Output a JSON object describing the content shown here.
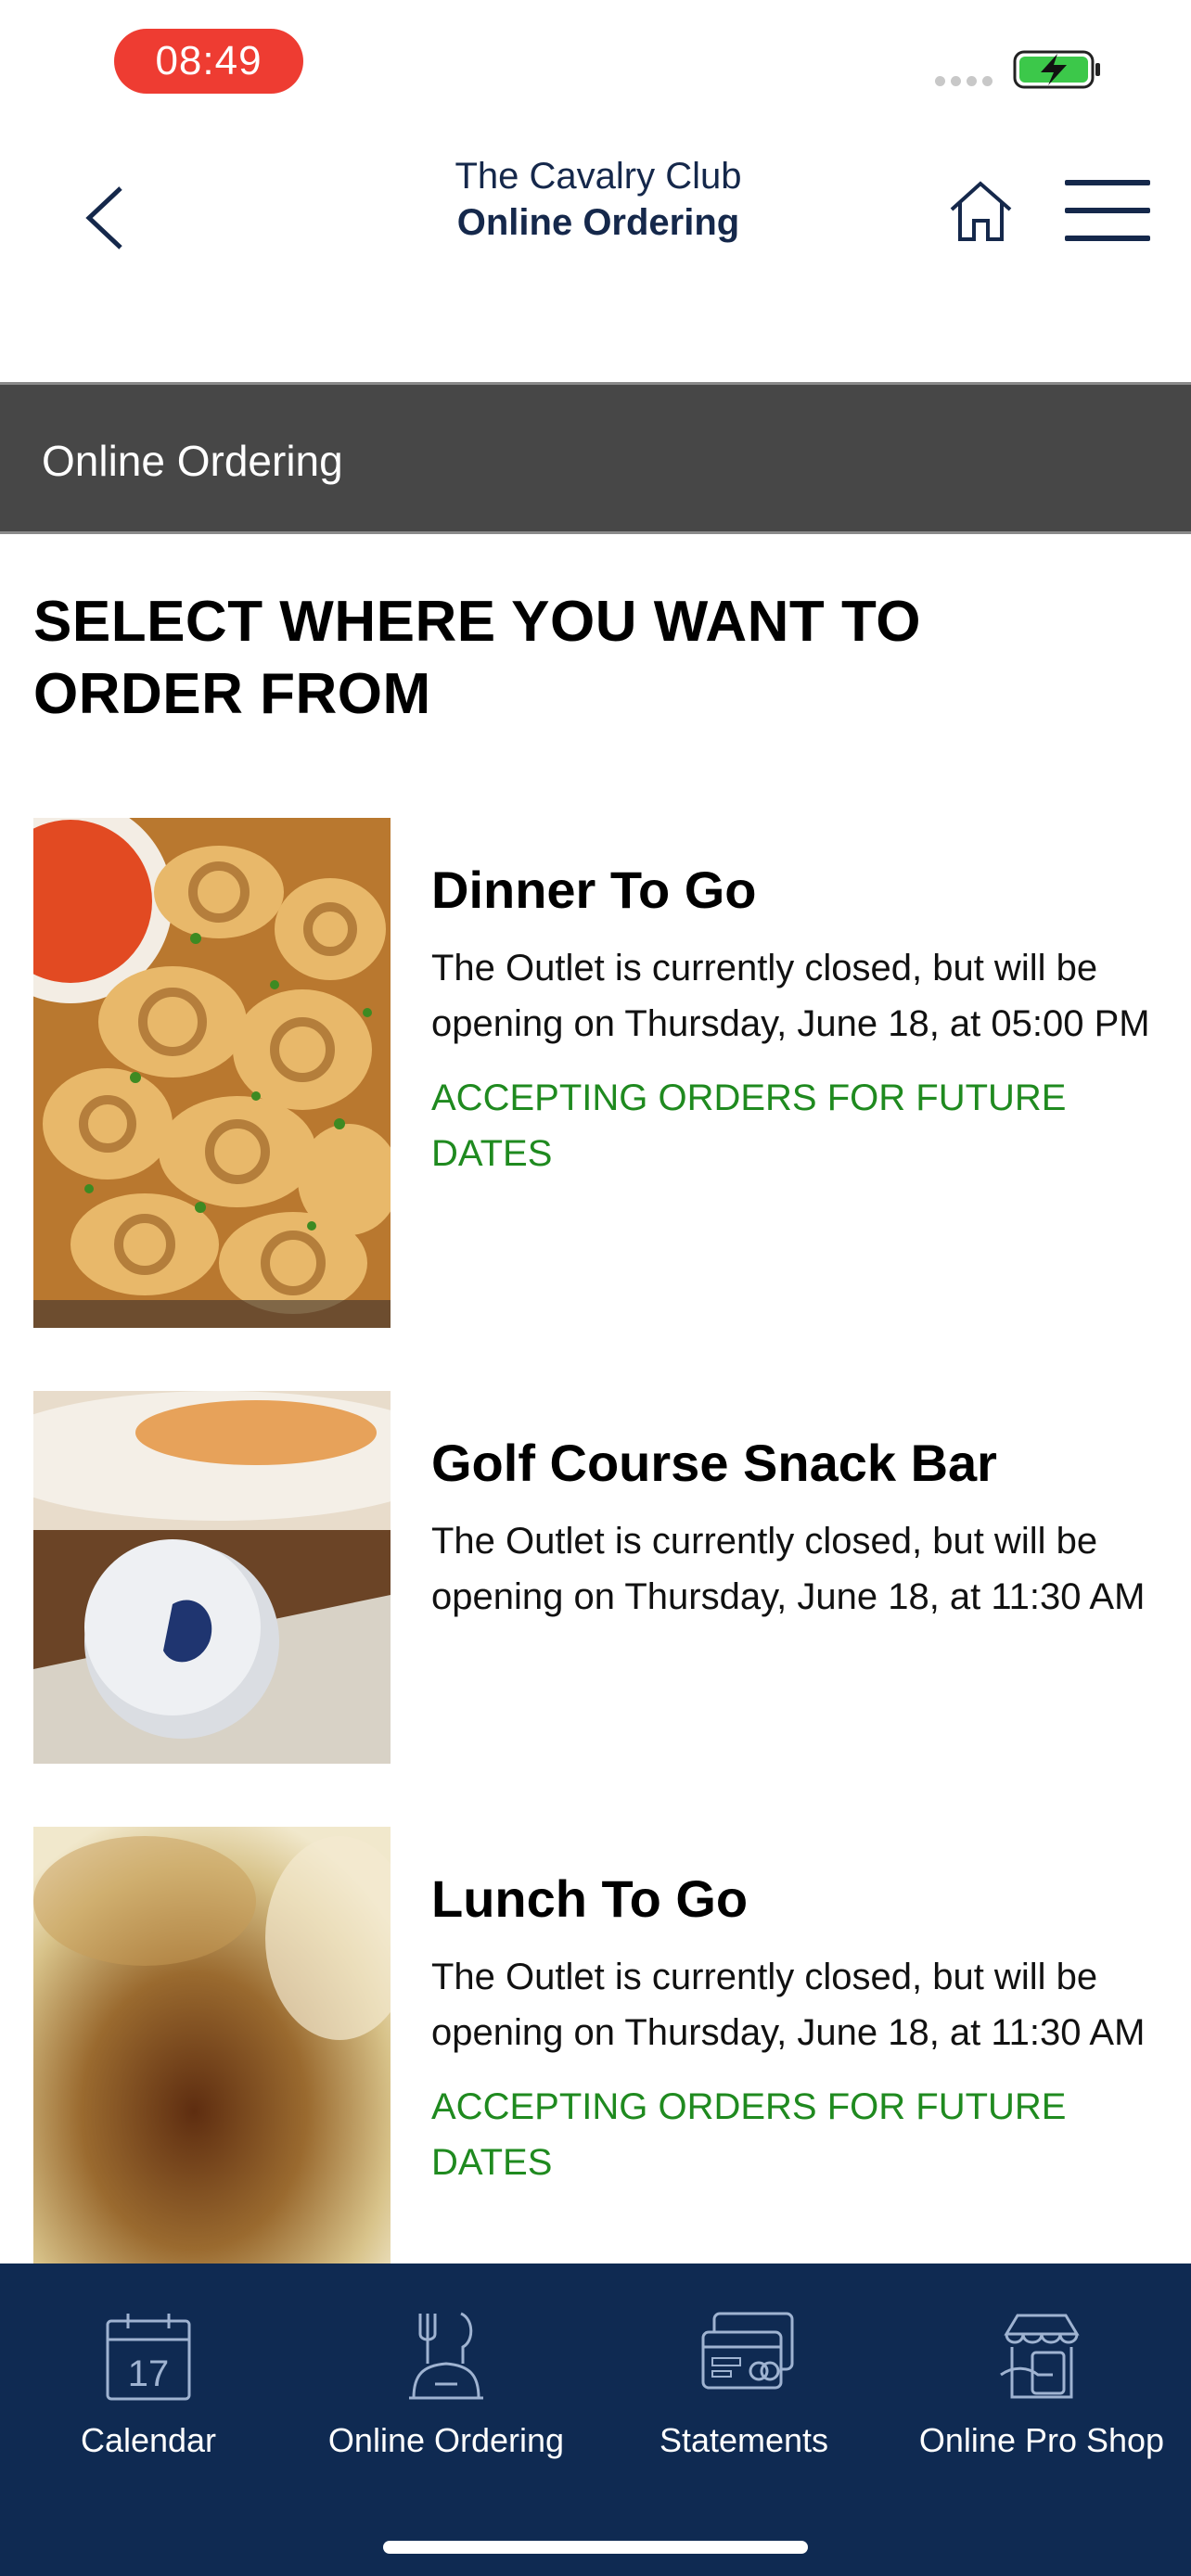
{
  "status_bar": {
    "time": "08:49",
    "battery_icon": "battery-charging-icon",
    "signal_icon": "signal-dots-icon"
  },
  "header": {
    "brand_line1": "The Cavalry Club",
    "brand_line2": "Online Ordering",
    "back_icon": "chevron-left-icon",
    "home_icon": "home-icon",
    "menu_icon": "hamburger-menu-icon"
  },
  "title_bar": {
    "title": "Online Ordering"
  },
  "main": {
    "heading_line1": "SELECT WHERE YOU WANT TO",
    "heading_line2": "ORDER FROM",
    "outlets": [
      {
        "name": "Dinner To Go",
        "status": "The Outlet is currently closed, but will be opening on Thursday, June 18, at 05:00 PM",
        "accepting": "ACCEPTING ORDERS FOR FUTURE DATES"
      },
      {
        "name": "Golf Course Snack Bar",
        "status": "The Outlet is currently closed, but will be opening on Thursday, June 18, at 11:30 AM",
        "accepting": ""
      },
      {
        "name": "Lunch To Go",
        "status": "The Outlet is currently closed, but will be opening on Thursday, June 18, at 11:30 AM",
        "accepting": "ACCEPTING ORDERS FOR FUTURE DATES"
      }
    ]
  },
  "tab_bar": {
    "tabs": [
      {
        "label": "Calendar",
        "icon": "calendar-icon",
        "icon_text": "17"
      },
      {
        "label": "Online Ordering",
        "icon": "food-order-icon"
      },
      {
        "label": "Statements",
        "icon": "statement-card-icon"
      },
      {
        "label": "Online Pro Shop",
        "icon": "shop-icon"
      }
    ]
  },
  "colors": {
    "brand_navy": "#15284b",
    "tabbar_bg": "#0f2a52",
    "titlebar_bg": "#474747",
    "accepting_green": "#1f8a1f",
    "time_pill": "#ee3c32"
  }
}
